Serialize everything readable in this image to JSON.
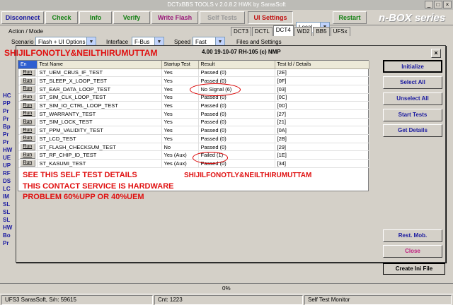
{
  "window": {
    "title": "DCTxBBS TOOLS v 2.0.8.2 HWK by SarasSoft"
  },
  "toolbar": {
    "disconnect": "Disconnect",
    "check": "Check",
    "info": "Info",
    "verify": "Verify",
    "write_flash": "Write Flash",
    "self_tests": "Self Tests",
    "ui_settings": "UI Settings",
    "mode": "Local",
    "restart": "Restart",
    "brand": "n-BOX series"
  },
  "action_mode": {
    "label": "Action / Mode",
    "scenario_label": "Scenario",
    "scenario_value": "Flash + UI Options",
    "interface_label": "Interface",
    "interface_value": "F-Bus",
    "speed_label": "Speed",
    "speed_value": "Fast"
  },
  "tabs": [
    "DCT3",
    "DCTL",
    "DCT4",
    "WD2",
    "BB5",
    "UFSx"
  ],
  "files_settings": "Files and Settings",
  "left_labels": [
    "HC",
    "PP",
    "Pr",
    "Pr",
    "Bp",
    "Pr",
    "Pr",
    "HW",
    "UE",
    "UP",
    "RF",
    "DS",
    "LC",
    "IM",
    "SL",
    "SL",
    "SL",
    "HW",
    "Bo",
    "Pr"
  ],
  "dialog": {
    "title": "4.00 19-10-07 RH-105 (c) NMP",
    "columns": [
      "En",
      "Test Name",
      "Startup Test",
      "Result",
      "Test Id / Details"
    ],
    "rows": [
      {
        "name": "ST_UEM_CBUS_IF_TEST",
        "startup": "Yes",
        "result": "Passed (0)",
        "id": "[2E]"
      },
      {
        "name": "ST_SLEEP_X_LOOP_TEST",
        "startup": "Yes",
        "result": "Passed (0)",
        "id": "[0F]"
      },
      {
        "name": "ST_EAR_DATA_LOOP_TEST",
        "startup": "Yes",
        "result": "No Signal (6)",
        "id": "[03]"
      },
      {
        "name": "ST_SIM_CLK_LOOP_TEST",
        "startup": "Yes",
        "result": "Passed (0)",
        "id": "[0C]"
      },
      {
        "name": "ST_SIM_IO_CTRL_LOOP_TEST",
        "startup": "Yes",
        "result": "Passed (0)",
        "id": "[0D]"
      },
      {
        "name": "ST_WARRANTY_TEST",
        "startup": "Yes",
        "result": "Passed (0)",
        "id": "[27]"
      },
      {
        "name": "ST_SIM_LOCK_TEST",
        "startup": "Yes",
        "result": "Passed (0)",
        "id": "[21]"
      },
      {
        "name": "ST_PPM_VALIDITY_TEST",
        "startup": "Yes",
        "result": "Passed (0)",
        "id": "[0A]"
      },
      {
        "name": "ST_LCD_TEST",
        "startup": "Yes",
        "result": "Passed (0)",
        "id": "[2B]"
      },
      {
        "name": "ST_FLASH_CHECKSUM_TEST",
        "startup": "No",
        "result": "Passed (0)",
        "id": "[29]"
      },
      {
        "name": "ST_RF_CHIP_ID_TEST",
        "startup": "Yes (Aux)",
        "result": "Failed (1)",
        "id": "[1E]"
      },
      {
        "name": "ST_KASUMI_TEST",
        "startup": "Yes (Aux)",
        "result": "Passed (0)",
        "id": "[34]"
      }
    ],
    "run_label": "Run",
    "buttons": {
      "initialize": "Initialize",
      "select_all": "Select All",
      "unselect_all": "Unselect All",
      "start_tests": "Start Tests",
      "get_details": "Get Details",
      "rest_mob": "Rest. Mob.",
      "close": "Close"
    }
  },
  "create_ini": "Create Ini File",
  "progress": {
    "percent": "0%"
  },
  "statusbar": {
    "left": "UFS3 SarasSoft, S/n: 59615",
    "cnt": "Cnt: 1223",
    "right": "Self Test Monitor"
  },
  "overlay": {
    "top_watermark": "SHIJILFONOTLY&NEILTHIRUMUTTAM",
    "mid_watermark": "SHIJILFONOTLY&NEILTHIRUMUTTAM",
    "line1": "SEE THIS SELF TEST DETAILS",
    "line2": "THIS CONTACT SERVICE IS HARDWARE",
    "line3": "PROBLEM 60%UPP OR 40%UEM"
  }
}
